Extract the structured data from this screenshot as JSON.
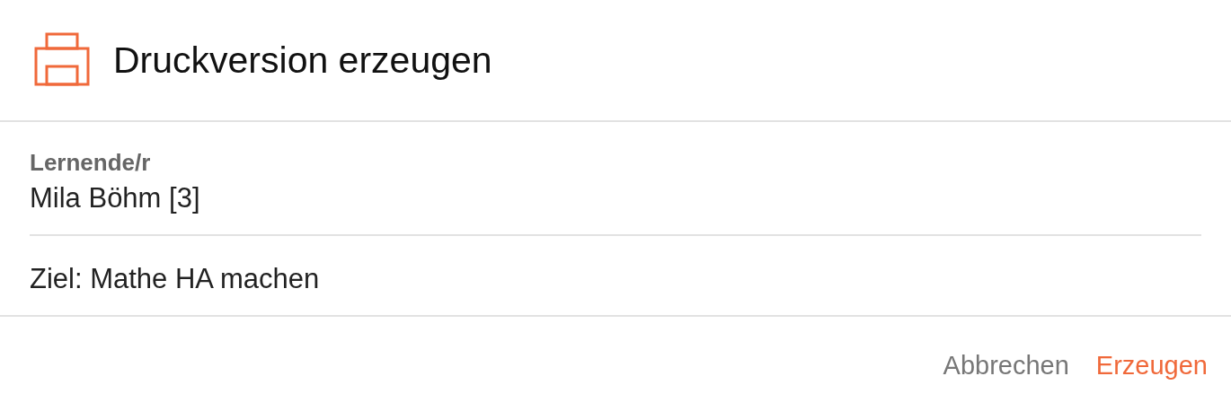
{
  "dialog": {
    "title": "Druckversion erzeugen"
  },
  "fields": [
    {
      "label": "Lernende/r",
      "value": "Mila Böhm [3]"
    }
  ],
  "goal": "Ziel: Mathe HA machen",
  "buttons": [
    {
      "label": "Abbrechen",
      "kind": "secondary"
    },
    {
      "label": "Erzeugen",
      "kind": "primary"
    }
  ]
}
